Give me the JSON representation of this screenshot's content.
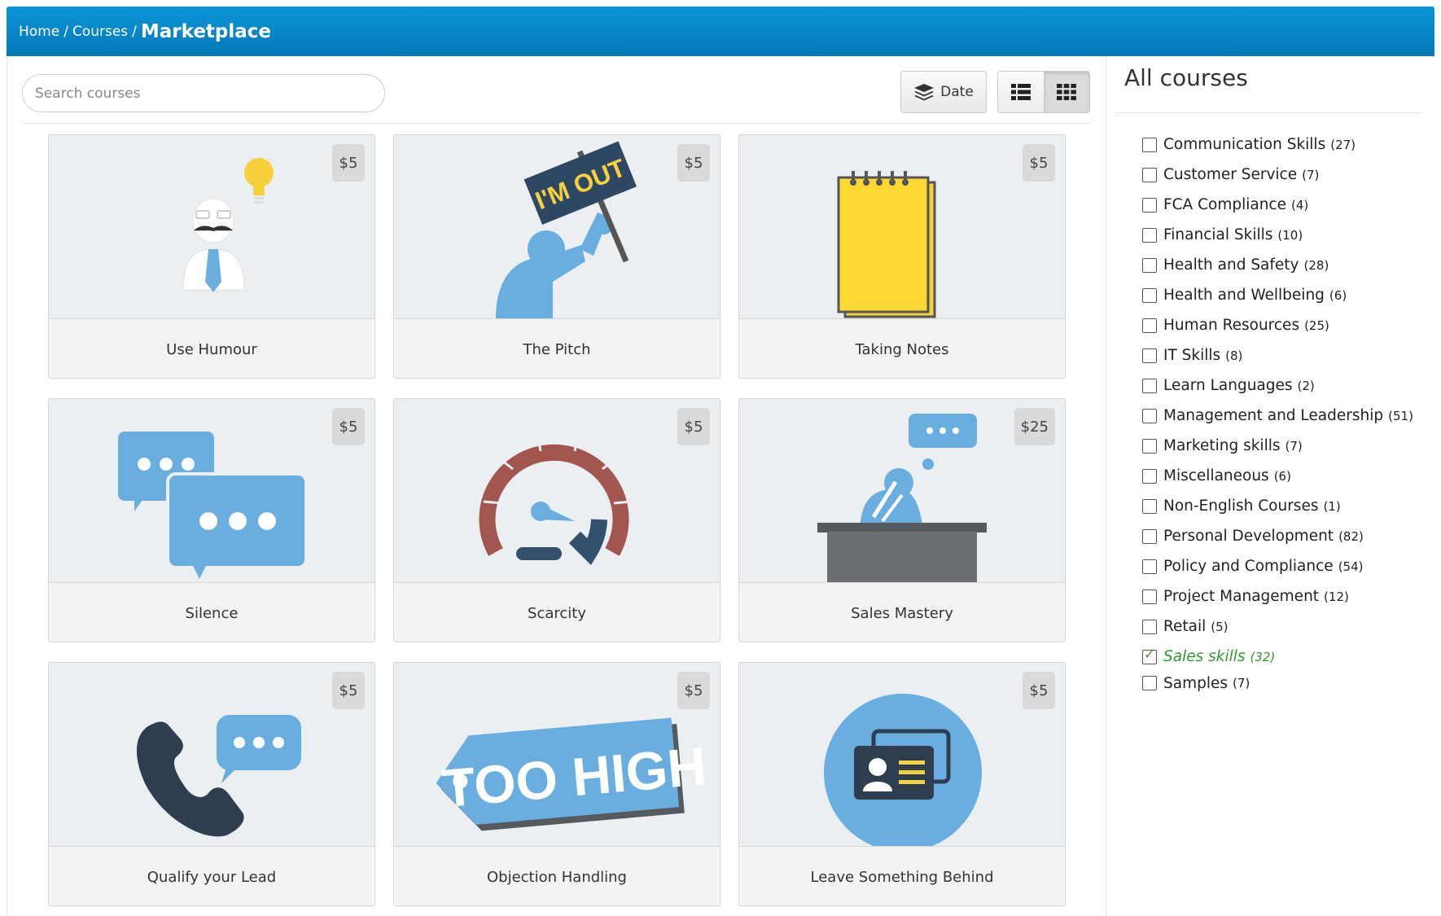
{
  "breadcrumb": {
    "home": "Home",
    "courses": "Courses",
    "current": "Marketplace",
    "separator": "/"
  },
  "toolbar": {
    "search_placeholder": "Search courses",
    "sort_label": "Date",
    "sort_icon": "layers-icon",
    "list_view_icon": "list-view-icon",
    "grid_view_icon": "grid-view-icon",
    "active_view": "grid"
  },
  "courses": [
    {
      "title": "Use Humour",
      "price": "$5",
      "image": "businessman-lightbulb"
    },
    {
      "title": "The Pitch",
      "price": "$5",
      "image": "im-out-sign"
    },
    {
      "title": "Taking Notes",
      "price": "$5",
      "image": "notepad"
    },
    {
      "title": "Silence",
      "price": "$5",
      "image": "speech-bubbles"
    },
    {
      "title": "Scarcity",
      "price": "$5",
      "image": "speedometer"
    },
    {
      "title": "Sales Mastery",
      "price": "$25",
      "image": "person-at-desk"
    },
    {
      "title": "Qualify your Lead",
      "price": "$5",
      "image": "phone-chat"
    },
    {
      "title": "Objection Handling",
      "price": "$5",
      "image": "too-high-tag"
    },
    {
      "title": "Leave Something Behind",
      "price": "$5",
      "image": "business-card"
    }
  ],
  "image_text": {
    "im_out": "I'M OUT",
    "too_high": "TOO HIGH"
  },
  "sidebar": {
    "title": "All courses",
    "categories": [
      {
        "name": "Communication Skills",
        "count": "(27)",
        "checked": false
      },
      {
        "name": "Customer Service",
        "count": "(7)",
        "checked": false
      },
      {
        "name": "FCA Compliance",
        "count": "(4)",
        "checked": false
      },
      {
        "name": "Financial Skills",
        "count": "(10)",
        "checked": false
      },
      {
        "name": "Health and Safety",
        "count": "(28)",
        "checked": false
      },
      {
        "name": "Health and Wellbeing",
        "count": "(6)",
        "checked": false
      },
      {
        "name": "Human Resources",
        "count": "(25)",
        "checked": false
      },
      {
        "name": "IT Skills",
        "count": "(8)",
        "checked": false
      },
      {
        "name": "Learn Languages",
        "count": "(2)",
        "checked": false
      },
      {
        "name": "Management and Leadership",
        "count": "(51)",
        "checked": false
      },
      {
        "name": "Marketing skills",
        "count": "(7)",
        "checked": false
      },
      {
        "name": "Miscellaneous",
        "count": "(6)",
        "checked": false
      },
      {
        "name": "Non-English Courses",
        "count": "(1)",
        "checked": false
      },
      {
        "name": "Personal Development",
        "count": "(82)",
        "checked": false
      },
      {
        "name": "Policy and Compliance",
        "count": "(54)",
        "checked": false
      },
      {
        "name": "Project Management",
        "count": "(12)",
        "checked": false
      },
      {
        "name": "Retail",
        "count": "(5)",
        "checked": false
      },
      {
        "name": "Sales skills",
        "count": "(32)",
        "checked": true
      },
      {
        "name": "Samples",
        "count": "(7)",
        "checked": false
      }
    ]
  },
  "colors": {
    "header_top": "#0a96d8",
    "header_bottom": "#0477b8",
    "illustration_blue": "#6aaee0",
    "illustration_dark": "#2e3d4f",
    "checked_green": "#2e9a2e",
    "price_badge": "#dadada"
  }
}
